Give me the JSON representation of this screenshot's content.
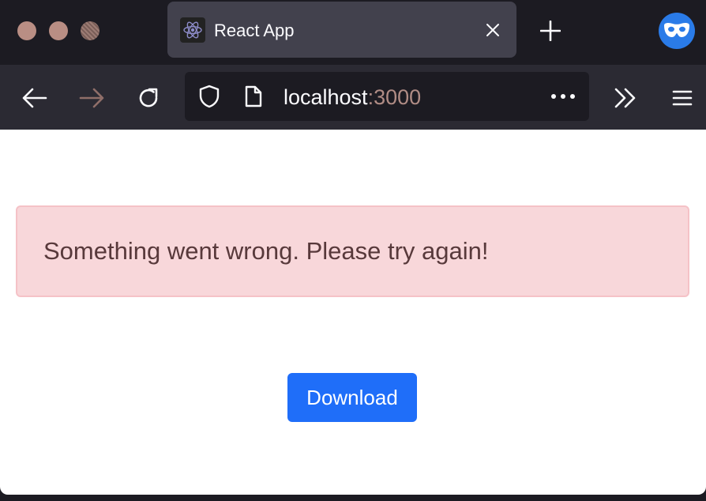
{
  "tab": {
    "title": "React App",
    "favicon": "react-icon"
  },
  "toolbar": {
    "back": "back-arrow-icon",
    "forward": "forward-arrow-icon",
    "reload": "reload-icon",
    "overflow": "chevrons-right-icon",
    "menu": "hamburger-menu-icon"
  },
  "urlbar": {
    "host": "localhost",
    "port": ":3000",
    "security_icon": "shield-icon",
    "page_icon": "page-icon",
    "actions_icon": "ellipsis-icon"
  },
  "page": {
    "alert_message": "Something went wrong. Please try again!",
    "download_label": "Download"
  },
  "colors": {
    "alert_bg": "#f8d7da",
    "alert_text": "#58393b",
    "button_bg": "#1f6ef9",
    "port_text": "#b08c85"
  }
}
